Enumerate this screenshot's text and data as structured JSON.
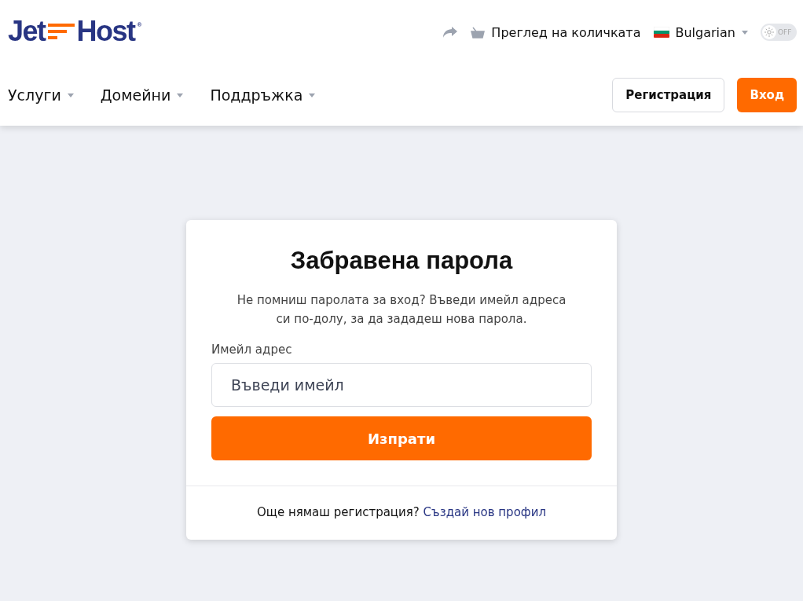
{
  "logo": {
    "left": "Jet",
    "right": "Host",
    "mark": "®"
  },
  "top_bar": {
    "cart": "Преглед на количката",
    "language": "Bulgarian",
    "dark_mode": {
      "label": "OFF",
      "on": false
    }
  },
  "nav": [
    {
      "label": "Услуги"
    },
    {
      "label": "Домейни"
    },
    {
      "label": "Поддръжка"
    }
  ],
  "header_buttons": [
    {
      "label": "Регистрация",
      "kind": "outline"
    },
    {
      "label": "Вход",
      "kind": "primary"
    }
  ],
  "card": {
    "title": "Забравена парола",
    "description": "Не помниш паролата за вход? Въведи имейл адреса си по-долу, за да зададеш нова парола.",
    "email_label": "Имейл адрес",
    "email_placeholder": "Въведи имейл",
    "submit": "Изпрати",
    "footer_text": "Още нямаш регистрация?",
    "footer_link": "Създай нов профил"
  }
}
